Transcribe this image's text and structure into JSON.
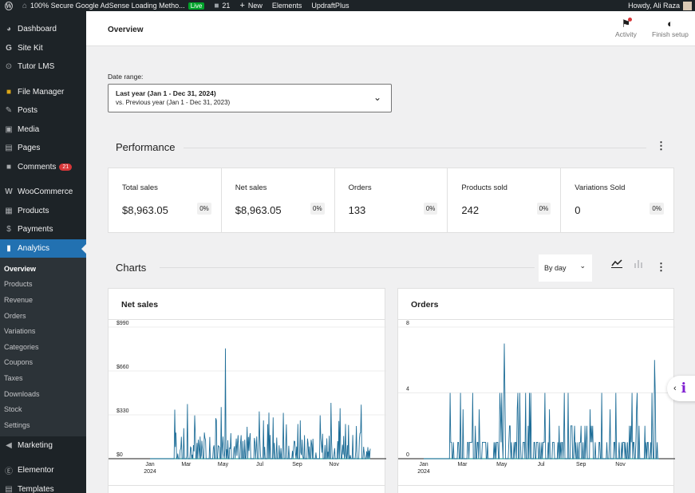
{
  "adminbar": {
    "site_title": "100% Secure Google AdSense Loading Metho...",
    "live_badge": "Live",
    "comments_count": "21",
    "new_label": "New",
    "elements_label": "Elements",
    "updraft_label": "UpdraftPlus",
    "howdy": "Howdy, Ali Raza"
  },
  "sidebar": {
    "dashboard": "Dashboard",
    "sitekit": "Site Kit",
    "tutor": "Tutor LMS",
    "filemanager": "File Manager",
    "posts": "Posts",
    "media": "Media",
    "pages": "Pages",
    "comments": "Comments",
    "comments_badge": "21",
    "woocommerce": "WooCommerce",
    "products": "Products",
    "payments": "Payments",
    "analytics": "Analytics",
    "submenu": [
      "Overview",
      "Products",
      "Revenue",
      "Orders",
      "Variations",
      "Categories",
      "Coupons",
      "Taxes",
      "Downloads",
      "Stock",
      "Settings"
    ],
    "marketing": "Marketing",
    "elementor": "Elementor",
    "templates": "Templates"
  },
  "header": {
    "title": "Overview",
    "activity": "Activity",
    "finish_setup": "Finish setup"
  },
  "date_range": {
    "label": "Date range:",
    "primary": "Last year (Jan 1 - Dec 31, 2024)",
    "secondary": "vs. Previous year (Jan 1 - Dec 31, 2023)"
  },
  "performance": {
    "title": "Performance",
    "cards": [
      {
        "label": "Total sales",
        "value": "$8,963.05",
        "delta": "0%"
      },
      {
        "label": "Net sales",
        "value": "$8,963.05",
        "delta": "0%"
      },
      {
        "label": "Orders",
        "value": "133",
        "delta": "0%"
      },
      {
        "label": "Products sold",
        "value": "242",
        "delta": "0%"
      },
      {
        "label": "Variations Sold",
        "value": "0",
        "delta": "0%"
      }
    ]
  },
  "charts_section": {
    "title": "Charts",
    "interval": "By day"
  },
  "colors": {
    "accent": "#2271b1",
    "series": "#1f6e98",
    "comparison": "#40a6a0"
  },
  "chart_data": [
    {
      "type": "line",
      "title": "Net sales",
      "ytick_labels": [
        "$990",
        "$660",
        "$330",
        "$0"
      ],
      "ylim": [
        0,
        990
      ],
      "xtick_labels": [
        "Jan",
        "Mar",
        "May",
        "Jul",
        "Sep",
        "Nov"
      ],
      "x_year_label": "2024",
      "series": [
        {
          "values": [
            0,
            0,
            0,
            0,
            0,
            0,
            0,
            0,
            0,
            0,
            0,
            0,
            0,
            0,
            0,
            0,
            0,
            0,
            0,
            0,
            0,
            0,
            0,
            0,
            0,
            0,
            0,
            0,
            0,
            0,
            0,
            0,
            0,
            0,
            0,
            0,
            0,
            0,
            0,
            0,
            0,
            0,
            0,
            0,
            0,
            0,
            0,
            0,
            0,
            0,
            0,
            0,
            0,
            0,
            0,
            0,
            0,
            0,
            0,
            0,
            0,
            0,
            0,
            0,
            0,
            0,
            0,
            0,
            0,
            0,
            0,
            0,
            0,
            0,
            0,
            0,
            0,
            0,
            0,
            0,
            0,
            0,
            0,
            0,
            0,
            0,
            0,
            0,
            0,
            0,
            0,
            0,
            0,
            0,
            0,
            0,
            0,
            0,
            0,
            0,
            0,
            0,
            0,
            0,
            0,
            0,
            0,
            0,
            0,
            0,
            0,
            0,
            0,
            0,
            0,
            0,
            0,
            0,
            0,
            0,
            0,
            0,
            0,
            0,
            0,
            0,
            0,
            0,
            0,
            0,
            0,
            0,
            0,
            0,
            0,
            0,
            0,
            0,
            0,
            0,
            0,
            0,
            0,
            0,
            0,
            0,
            0,
            0,
            0,
            0,
            0,
            0,
            0,
            0,
            0,
            0,
            0,
            0,
            0,
            0,
            0,
            0,
            0,
            0,
            0,
            0,
            0,
            0,
            0,
            0,
            0,
            0,
            0,
            0,
            0,
            0,
            0,
            0,
            0,
            0,
            0,
            0,
            0,
            0,
            0,
            0,
            0,
            0,
            0,
            0,
            0,
            0,
            0,
            0,
            0,
            0,
            0,
            0,
            0,
            0,
            0,
            0,
            0,
            0,
            0,
            0,
            0,
            0,
            0,
            0,
            0,
            0,
            0,
            0,
            0,
            0,
            0,
            0,
            0,
            0,
            0,
            0,
            0,
            0,
            0,
            0,
            0,
            0,
            0,
            0,
            0,
            0,
            0,
            0,
            0,
            0,
            0,
            0,
            0,
            0,
            0,
            0,
            0,
            0,
            0,
            0,
            0,
            0,
            0,
            0,
            0,
            0,
            0,
            0,
            0,
            0,
            0,
            0,
            0,
            0,
            0,
            0,
            0,
            0,
            0,
            0,
            0,
            0,
            0,
            0,
            0,
            0,
            0,
            0,
            0,
            0,
            0,
            0,
            0,
            0,
            0,
            0,
            0,
            0,
            0,
            0,
            0,
            0,
            0,
            0,
            0,
            0,
            0,
            0,
            0,
            0,
            0,
            0,
            0,
            0,
            0,
            0,
            0,
            0,
            0,
            0,
            0,
            0,
            0,
            0,
            0,
            0,
            0,
            0,
            0,
            0,
            0,
            0,
            0,
            0,
            0,
            0,
            0,
            0,
            0,
            0,
            0,
            0,
            0,
            0,
            0,
            0,
            0,
            0,
            0,
            0,
            0,
            0,
            0,
            0,
            0,
            0,
            0,
            0,
            0,
            0,
            0,
            0,
            0,
            0,
            0,
            0,
            0,
            0,
            0,
            0,
            0,
            0,
            0,
            0,
            0,
            0,
            0,
            0,
            0,
            0,
            0,
            0,
            0,
            0,
            0,
            0,
            0,
            0,
            0,
            0,
            0,
            0,
            0,
            0,
            0,
            0,
            0,
            0,
            0,
            0
          ]
        },
        {
          "values": [
            0,
            0,
            0,
            0,
            0,
            0,
            0,
            0,
            0,
            0,
            0,
            0,
            0,
            0,
            0,
            0,
            0,
            0,
            0,
            0,
            0,
            0,
            0,
            0,
            0,
            0,
            0,
            0,
            0,
            0,
            0,
            0,
            0,
            0,
            0,
            0,
            0,
            0,
            0,
            0,
            0,
            0,
            0,
            0,
            0,
            0,
            0,
            0,
            0,
            0,
            0,
            0,
            0,
            0,
            0,
            0,
            0,
            0,
            0,
            0,
            0,
            0,
            0,
            0,
            0,
            0,
            0,
            0,
            0,
            0,
            0,
            0,
            0,
            0,
            0,
            0,
            0,
            0,
            0,
            0,
            0,
            0,
            0,
            0,
            0,
            0,
            0,
            0,
            0,
            0,
            0,
            0,
            0,
            0,
            0,
            0,
            0,
            0,
            0,
            0,
            0,
            0,
            0,
            0,
            0,
            0,
            0,
            0,
            0,
            0,
            0,
            0,
            0,
            0,
            0,
            0,
            0,
            0,
            0,
            0,
            0,
            0,
            0,
            0,
            0,
            0,
            0,
            0,
            0,
            0,
            0,
            0,
            0,
            0,
            0,
            0,
            0,
            0,
            0,
            0,
            0,
            0,
            0,
            0,
            0,
            0,
            0,
            0,
            0,
            0,
            0,
            0,
            0,
            0,
            0,
            0,
            0,
            0,
            0,
            0,
            0,
            0,
            0,
            0,
            0,
            0,
            0,
            0,
            0,
            0,
            0,
            0,
            0,
            0,
            0,
            0,
            0,
            0,
            0,
            0,
            0,
            0,
            0,
            0,
            0,
            0,
            0,
            0,
            0,
            0,
            0,
            0,
            0,
            0,
            0,
            0,
            0,
            0,
            0,
            0,
            0,
            0,
            0,
            0,
            0,
            0,
            0,
            0,
            0,
            0,
            0,
            0,
            0,
            0,
            0,
            0,
            0,
            0,
            0,
            0,
            0,
            0,
            0,
            0,
            0,
            0,
            0,
            0,
            0,
            0,
            0,
            0,
            0,
            0,
            0,
            0,
            0,
            0,
            0,
            0,
            0,
            0,
            0,
            0,
            0,
            0,
            0,
            0,
            0,
            0,
            0,
            0,
            0,
            0,
            0,
            0,
            0,
            0,
            0,
            0,
            0,
            0,
            0,
            0,
            0,
            0,
            0,
            0,
            0,
            0,
            0,
            0,
            0,
            0,
            0,
            0,
            0,
            0,
            0,
            0,
            0,
            0,
            0,
            0,
            0,
            0,
            0,
            0,
            0,
            0,
            0,
            0,
            0,
            0,
            0,
            0,
            0,
            0,
            0,
            0,
            0,
            0,
            0,
            0,
            0,
            0,
            0,
            0,
            0,
            0,
            0,
            0,
            0,
            0,
            0,
            0,
            0,
            0,
            0,
            0,
            0,
            0,
            0,
            0,
            0,
            0,
            0,
            0,
            0,
            0,
            0,
            0,
            0,
            0,
            0,
            0,
            0,
            0,
            0,
            0,
            0,
            0,
            0,
            0,
            0,
            0,
            0,
            0,
            0,
            0,
            0,
            0,
            0,
            0,
            0,
            0,
            0,
            0,
            0,
            0,
            0,
            0,
            0,
            0,
            0,
            0,
            0,
            0,
            0,
            0,
            0,
            0,
            0,
            0,
            0,
            0,
            0
          ]
        }
      ]
    },
    {
      "type": "line",
      "title": "Orders",
      "ytick_labels": [
        "8",
        "4",
        "0"
      ],
      "ylim": [
        0,
        8
      ],
      "xtick_labels": [
        "Jan",
        "Mar",
        "May",
        "Jul",
        "Sep",
        "Nov"
      ],
      "x_year_label": "2024",
      "series": [
        {
          "values": []
        },
        {
          "values": []
        }
      ]
    }
  ]
}
